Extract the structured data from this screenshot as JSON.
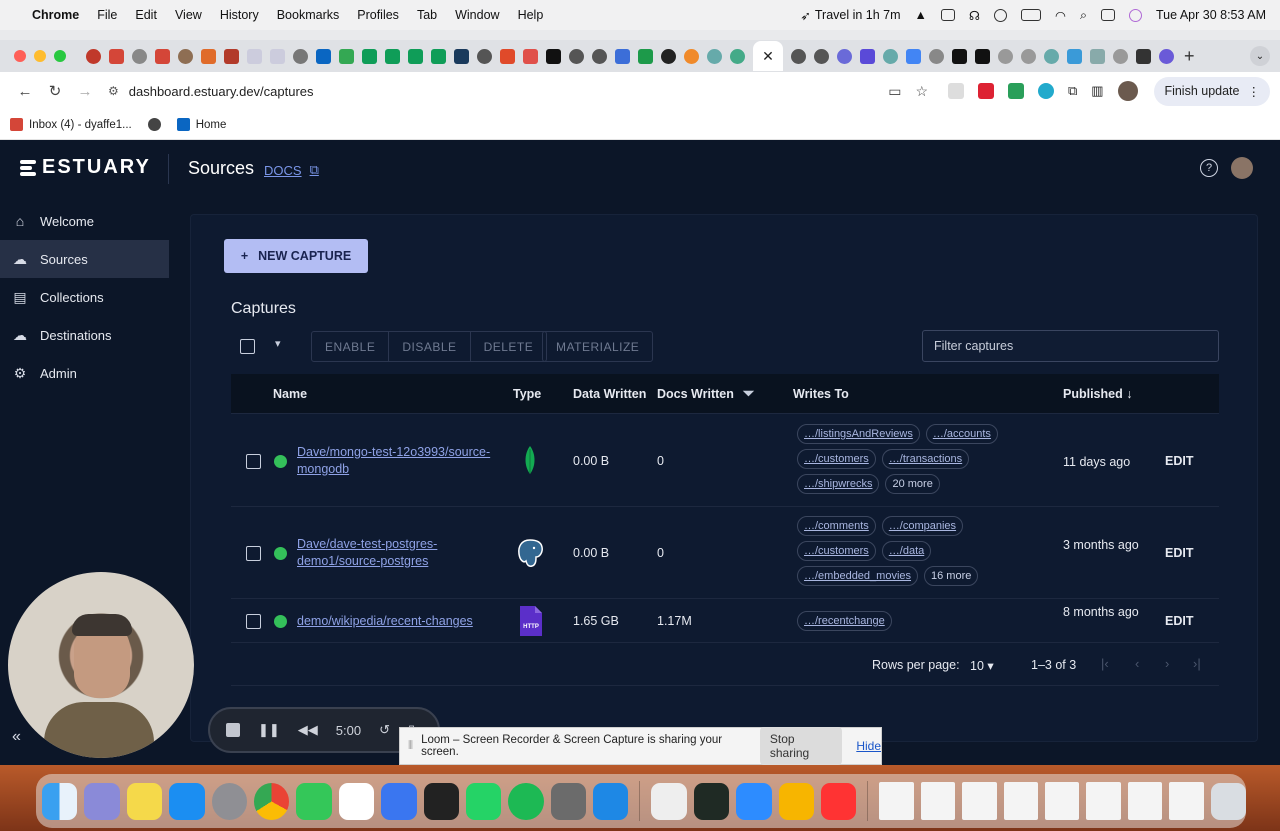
{
  "menubar": {
    "app_name": "Chrome",
    "items": [
      "File",
      "Edit",
      "View",
      "History",
      "Bookmarks",
      "Profiles",
      "Tab",
      "Window",
      "Help"
    ],
    "travel_status": "Travel in 1h 7m",
    "datetime": "Tue Apr 30  8:53 AM"
  },
  "browser": {
    "url": "dashboard.estuary.dev/captures",
    "finish_update_label": "Finish update",
    "bookmarks": [
      "Inbox (4) - dyaffe1...",
      "Home"
    ]
  },
  "app": {
    "logo_text": "ESTUARY",
    "page_title": "Sources",
    "docs_label": "DOCS",
    "sidebar": {
      "items": [
        {
          "label": "Welcome",
          "icon": "home-icon"
        },
        {
          "label": "Sources",
          "icon": "cloud-upload-icon"
        },
        {
          "label": "Collections",
          "icon": "database-icon"
        },
        {
          "label": "Destinations",
          "icon": "cloud-download-icon"
        },
        {
          "label": "Admin",
          "icon": "gear-icon"
        }
      ],
      "active": "Sources"
    },
    "new_capture_label": "NEW CAPTURE",
    "captures_title": "Captures",
    "actions": [
      "ENABLE",
      "DISABLE",
      "DELETE"
    ],
    "materialize_label": "MATERIALIZE",
    "filter_placeholder": "Filter captures",
    "table": {
      "columns": [
        "Name",
        "Type",
        "Data Written",
        "Docs Written",
        "Writes To",
        "Published"
      ],
      "rows": [
        {
          "name": "Dave/mongo-test-12o3993/source-mongodb",
          "type": "mongodb-icon",
          "data_written": "0.00 B",
          "docs_written": "0",
          "writes_to": [
            [
              "…/listingsAndReviews",
              "…/accounts"
            ],
            [
              "…/customers",
              "…/transactions"
            ],
            [
              "…/shipwrecks",
              "20 more"
            ]
          ],
          "published": "11 days ago",
          "action": "EDIT"
        },
        {
          "name": "Dave/dave-test-postgres-demo1/source-postgres",
          "type": "postgres-icon",
          "data_written": "0.00 B",
          "docs_written": "0",
          "writes_to": [
            [
              "…/comments",
              "…/companies"
            ],
            [
              "…/customers",
              "…/data"
            ],
            [
              "…/embedded_movies",
              "16 more"
            ]
          ],
          "published": "3 months ago",
          "action": "EDIT"
        },
        {
          "name": "demo/wikipedia/recent-changes",
          "type": "http-file-icon",
          "data_written": "1.65 GB",
          "docs_written": "1.17M",
          "writes_to": [
            [
              "…/recentchange"
            ]
          ],
          "published": "8 months ago",
          "action": "EDIT"
        }
      ]
    },
    "pagination": {
      "rows_per_page_label": "Rows per page:",
      "rows_per_page": "10",
      "range": "1–3 of 3"
    }
  },
  "loom": {
    "time": "5:00",
    "share_message": "Loom – Screen Recorder & Screen Capture is sharing your screen.",
    "stop_label": "Stop sharing",
    "hide_label": "Hide"
  },
  "colors": {
    "app_bg": "#0c1628",
    "accent_button": "#b3bdf3",
    "status_active": "#34c05a",
    "link": "#8fa2e6"
  }
}
